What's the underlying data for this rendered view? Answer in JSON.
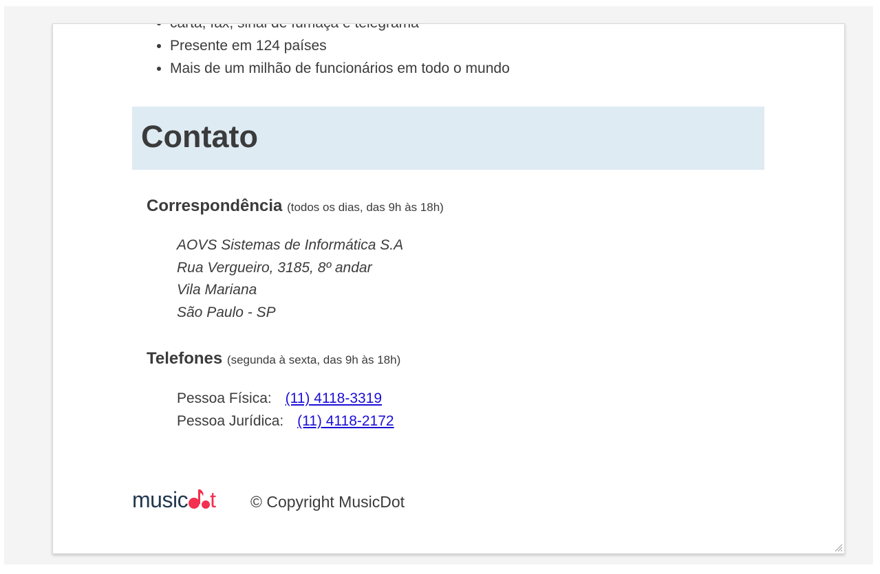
{
  "features": [
    "carta, fax, sinal de fumaça e telegrama",
    "Presente em 124 países",
    "Mais de um milhão de funcionários em todo o mundo"
  ],
  "contact": {
    "title": "Contato",
    "mail": {
      "heading": "Correspondência",
      "note": "(todos os dias, das 9h às 18h)",
      "address": [
        "AOVS Sistemas de Informática S.A",
        "Rua Vergueiro, 3185, 8º andar",
        "Vila Mariana",
        "São Paulo - SP"
      ]
    },
    "phones": {
      "heading": "Telefones",
      "note": "(segunda à sexta, das 9h às 18h)",
      "items": [
        {
          "label": "Pessoa Física:",
          "number": "(11) 4118-3319"
        },
        {
          "label": "Pessoa Jurídica:",
          "number": "(11) 4118-2172"
        }
      ]
    }
  },
  "footer": {
    "logo_text_start": "music",
    "logo_text_end": "t",
    "copyright": "© Copyright MusicDot"
  },
  "colors": {
    "contact_bar": "#deebf3",
    "link": "#1a0dd6",
    "logo_dark": "#24394f",
    "logo_accent": "#f3304f"
  }
}
